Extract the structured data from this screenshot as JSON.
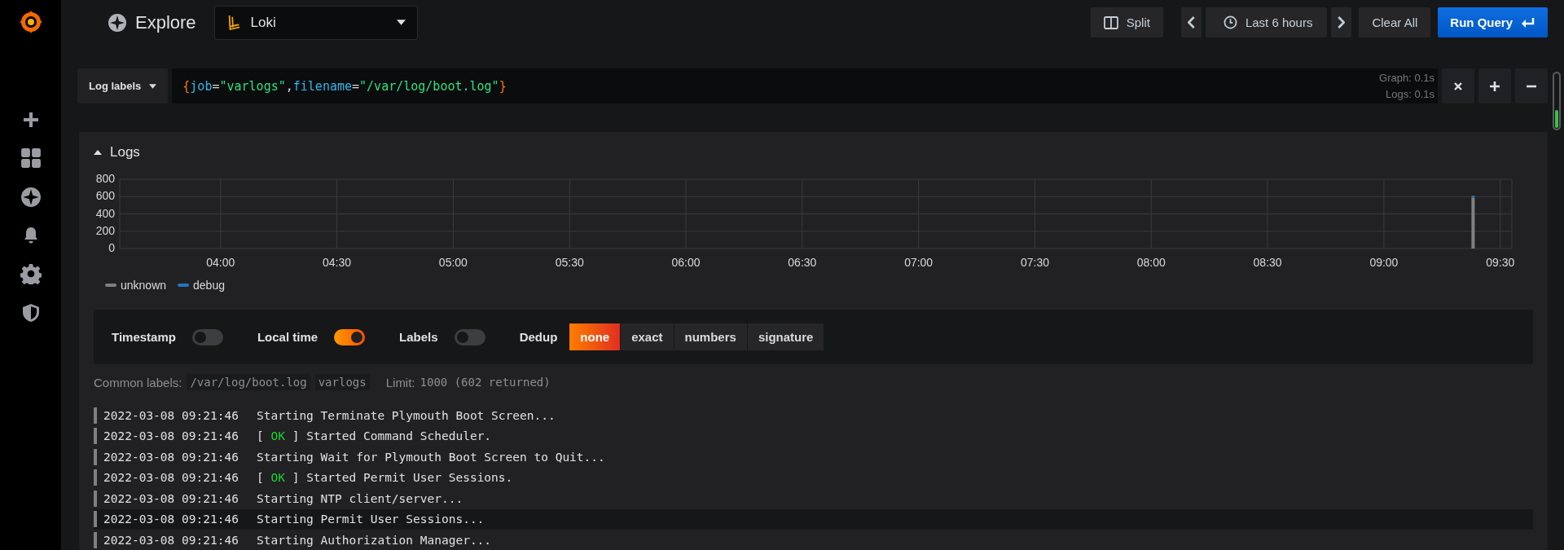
{
  "topbar": {
    "title": "Explore",
    "datasource": "Loki",
    "split": "Split",
    "time_range": "Last 6 hours",
    "clear": "Clear All",
    "run": "Run Query"
  },
  "query": {
    "label_button": "Log labels",
    "tokens": [
      {
        "text": "{",
        "kind": "brace"
      },
      {
        "text": "job",
        "kind": "key"
      },
      {
        "text": "=",
        "kind": "op"
      },
      {
        "text": "\"varlogs\"",
        "kind": "string"
      },
      {
        "text": ",",
        "kind": "op"
      },
      {
        "text": "filename",
        "kind": "key"
      },
      {
        "text": "=",
        "kind": "op"
      },
      {
        "text": "\"/var/log/boot.log\"",
        "kind": "string"
      },
      {
        "text": "}",
        "kind": "brace"
      }
    ],
    "stats": [
      "Graph: 0.1s",
      "Logs: 0.1s"
    ]
  },
  "logs_panel": {
    "title": "Logs",
    "expanded": true,
    "chart_data": {
      "type": "bar",
      "stacked": true,
      "grid": true,
      "x": [
        563
      ],
      "xlim": [
        214,
        573
      ],
      "ylim": [
        0,
        800
      ],
      "series": [
        {
          "name": "unknown",
          "color": "#808080",
          "values": [
            590
          ]
        },
        {
          "name": "debug",
          "color": "#1f78c1",
          "values": [
            20
          ]
        }
      ],
      "xticks": [
        {
          "value": 240,
          "label": "04:00"
        },
        {
          "value": 270,
          "label": "04:30"
        },
        {
          "value": 300,
          "label": "05:00"
        },
        {
          "value": 330,
          "label": "05:30"
        },
        {
          "value": 360,
          "label": "06:00"
        },
        {
          "value": 390,
          "label": "06:30"
        },
        {
          "value": 420,
          "label": "07:00"
        },
        {
          "value": 450,
          "label": "07:30"
        },
        {
          "value": 480,
          "label": "08:00"
        },
        {
          "value": 510,
          "label": "08:30"
        },
        {
          "value": 540,
          "label": "09:00"
        },
        {
          "value": 570,
          "label": "09:30"
        }
      ],
      "yticks": [
        0,
        200,
        400,
        600,
        800
      ]
    },
    "options": {
      "switches": [
        {
          "label": "Timestamp",
          "on": false
        },
        {
          "label": "Local time",
          "on": true
        },
        {
          "label": "Labels",
          "on": false
        }
      ],
      "dedup_label": "Dedup",
      "dedup": [
        {
          "label": "none",
          "selected": true
        },
        {
          "label": "exact",
          "selected": false
        },
        {
          "label": "numbers",
          "selected": false
        },
        {
          "label": "signature",
          "selected": false
        }
      ]
    },
    "common_labels": {
      "label": "Common labels:",
      "values": [
        "/var/log/boot.log",
        "varlogs"
      ]
    },
    "limit": {
      "label": "Limit:",
      "value": "1000 (602 returned)"
    },
    "rows": [
      {
        "time": "2022-03-08 09:21:46",
        "hovered": false,
        "parts": [
          {
            "text": "Starting Terminate Plymouth Boot Screen...",
            "kind": "plain"
          }
        ]
      },
      {
        "time": "2022-03-08 09:21:46",
        "hovered": false,
        "parts": [
          {
            "text": "[ ",
            "kind": "plain"
          },
          {
            "text": "OK",
            "kind": "ok"
          },
          {
            "text": " ] Started Command Scheduler.",
            "kind": "plain"
          }
        ]
      },
      {
        "time": "2022-03-08 09:21:46",
        "hovered": false,
        "parts": [
          {
            "text": "Starting Wait for Plymouth Boot Screen to Quit...",
            "kind": "plain"
          }
        ]
      },
      {
        "time": "2022-03-08 09:21:46",
        "hovered": false,
        "parts": [
          {
            "text": "[ ",
            "kind": "plain"
          },
          {
            "text": "OK",
            "kind": "ok"
          },
          {
            "text": " ] Started Permit User Sessions.",
            "kind": "plain"
          }
        ]
      },
      {
        "time": "2022-03-08 09:21:46",
        "hovered": false,
        "parts": [
          {
            "text": "Starting NTP client/server...",
            "kind": "plain"
          }
        ]
      },
      {
        "time": "2022-03-08 09:21:46",
        "hovered": true,
        "parts": [
          {
            "text": "Starting Permit User Sessions...",
            "kind": "plain"
          }
        ]
      },
      {
        "time": "2022-03-08 09:21:46",
        "hovered": false,
        "parts": [
          {
            "text": "Starting Authorization Manager...",
            "kind": "plain"
          }
        ]
      }
    ]
  }
}
